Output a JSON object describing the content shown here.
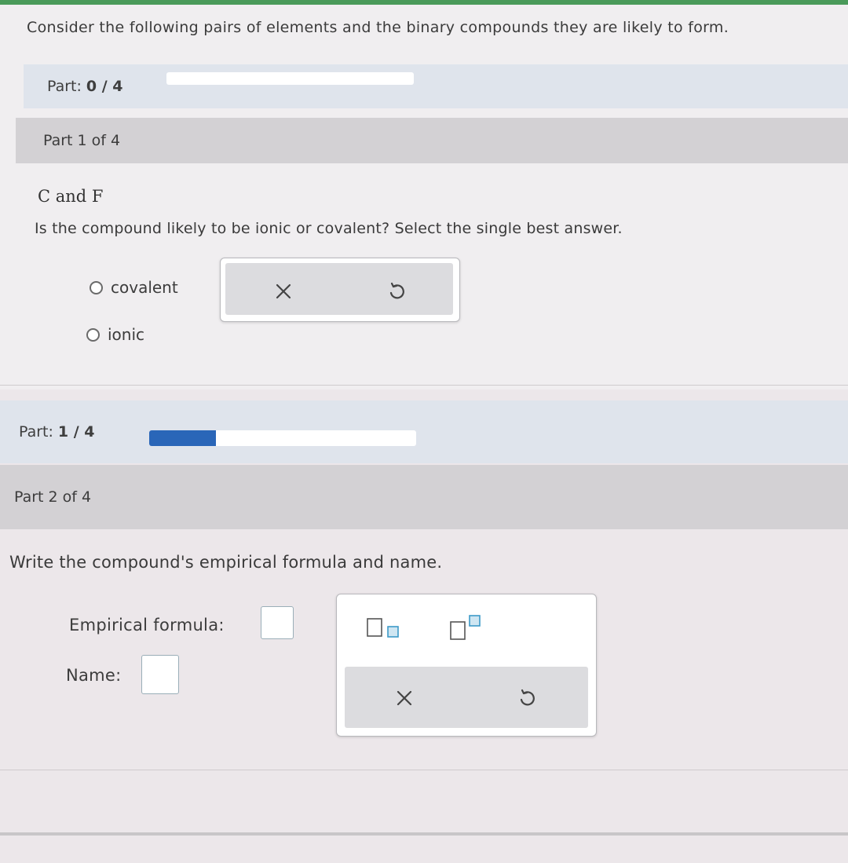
{
  "intro_text": "Consider the following pairs of elements and the binary compounds they are likely to form.",
  "part_progress_1": {
    "label": "Part:",
    "value": "0 / 4",
    "fraction": 0.0
  },
  "part1": {
    "header": "Part 1 of 4",
    "elements": "C and F",
    "question": "Is the compound likely to be ionic or covalent? Select the single best answer.",
    "options": [
      "covalent",
      "ionic"
    ]
  },
  "part_progress_2": {
    "label": "Part:",
    "value": "1 / 4",
    "fraction": 0.25
  },
  "part2": {
    "header": "Part 2 of 4",
    "question": "Write the compound's empirical formula and name.",
    "empirical_formula_label": "Empirical formula:",
    "name_label": "Name:"
  },
  "icons": {
    "clear": "close-icon",
    "undo": "undo-icon",
    "subscript": "subscript-icon",
    "superscript": "superscript-icon"
  },
  "colors": {
    "progress_fill": "#2a66b8",
    "part_bar": "#dfe4ec",
    "part_header": "#d3d1d4",
    "template_accent": "#3d9ac8"
  }
}
